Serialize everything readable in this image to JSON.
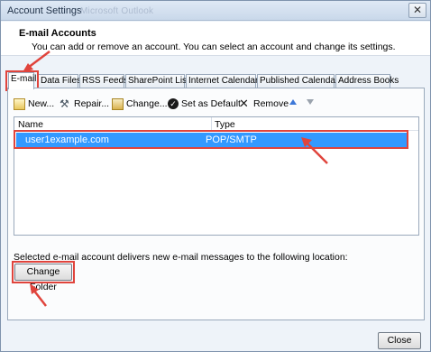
{
  "window": {
    "title": "Account Settings",
    "ghost_text": "Microsoft Outlook"
  },
  "header": {
    "title": "E-mail Accounts",
    "description": "You can add or remove an account. You can select an account and change its settings."
  },
  "tabs": [
    {
      "label": "E-mail",
      "active": true
    },
    {
      "label": "Data Files"
    },
    {
      "label": "RSS Feeds"
    },
    {
      "label": "SharePoint Lists"
    },
    {
      "label": "Internet Calendars"
    },
    {
      "label": "Published Calendars"
    },
    {
      "label": "Address Books"
    }
  ],
  "toolbar": {
    "new_label": "New...",
    "repair_label": "Repair...",
    "change_label": "Change...",
    "set_default_label": "Set as Default",
    "remove_label": "Remove",
    "move_up_icon": "arrow-up-icon",
    "move_down_icon": "arrow-down-icon"
  },
  "accounts_list": {
    "columns": [
      "Name",
      "Type"
    ],
    "rows": [
      {
        "name": "user1example.com",
        "type": "POP/SMTP",
        "selected": true
      }
    ]
  },
  "footer": {
    "delivery_note": "Selected e-mail account delivers new e-mail messages to the following location:",
    "change_folder_label": "Change Folder",
    "close_label": "Close"
  },
  "colors": {
    "highlight_red": "#e0443c",
    "selection_blue": "#3399ff"
  }
}
